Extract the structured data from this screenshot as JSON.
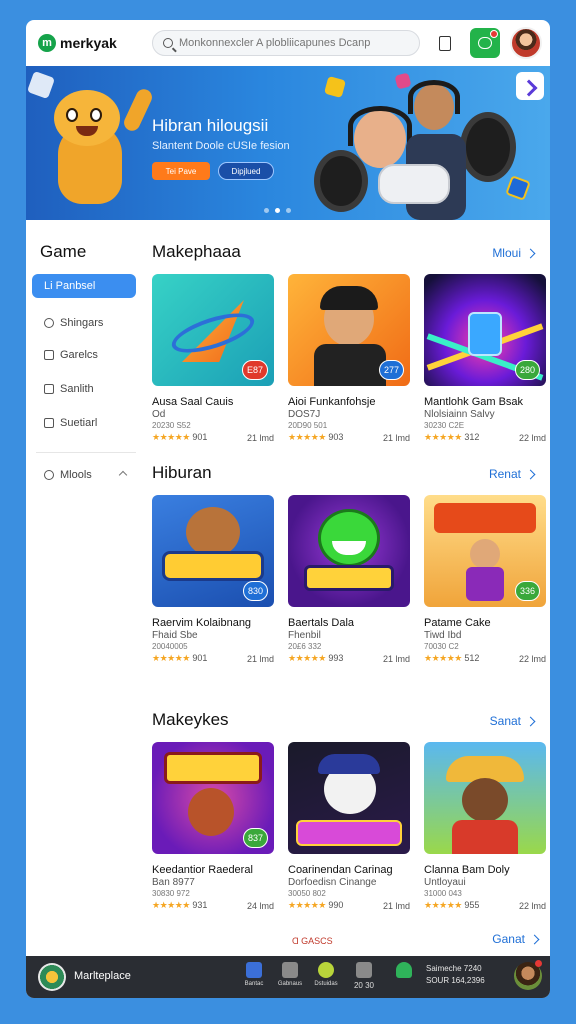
{
  "header": {
    "logo_mark": "m",
    "logo_text": "merkyak",
    "search_placeholder": "Monkonnexcler A plobliicapunes Dcanp"
  },
  "banner": {
    "title": "Hibran hilougsii",
    "subtitle": "Slantent Doole cUSIe fesion",
    "primary_button": "Tei Pave",
    "secondary_button": "Dipjlued",
    "dots": 3,
    "active_dot": 1
  },
  "sidebar": {
    "title": "Game",
    "items": [
      {
        "label": "Li Panbsel",
        "icon": "list-icon"
      },
      {
        "label": "Shingars",
        "icon": "person-icon"
      },
      {
        "label": "Garelcs",
        "icon": "square-icon"
      },
      {
        "label": "Sanlith",
        "icon": "home-icon"
      },
      {
        "label": "Suetiarl",
        "icon": "tag-icon"
      },
      {
        "label": "Mlools",
        "icon": "search-icon"
      }
    ]
  },
  "sections": [
    {
      "title": "Makephaaa",
      "more": "Mloui",
      "cards": [
        {
          "name": "Ausa Saal Cauis",
          "sub": "Od",
          "meta": "20230 S52",
          "stars": "★★★★★",
          "rating": "901",
          "size": "21 lmd",
          "badge": "E87",
          "badge_color": "#e0392b"
        },
        {
          "name": "Aioi Funkanfohsje",
          "sub": "DOS7J",
          "meta": "20D90 501",
          "stars": "★★★★★",
          "rating": "903",
          "size": "21 lmd",
          "badge": "277",
          "badge_color": "#1f6fd6"
        },
        {
          "name": "Mantlohk Gam Bsak",
          "sub": "Nlolsiainn Salvy",
          "meta": "30230 C2E",
          "stars": "★★★★★",
          "rating": "312",
          "size": "22 lmd",
          "badge": "280",
          "badge_color": "#3aa83a"
        }
      ]
    },
    {
      "title": "Hiburan",
      "more": "Renat",
      "cards": [
        {
          "name": "Raervim Kolaibnang",
          "sub": "Fhaid Sbe",
          "meta": "20040005",
          "stars": "★★★★★",
          "rating": "901",
          "size": "21 lmd",
          "badge": "830",
          "badge_color": "#1f6fd6"
        },
        {
          "name": "Baertals Dala",
          "sub": "Fhenbil",
          "meta": "20£6 332",
          "stars": "★★★★★",
          "rating": "993",
          "size": "21 lmd",
          "badge": "",
          "badge_color": ""
        },
        {
          "name": "Patame Cake",
          "sub": "Tiwd Ibd",
          "meta": "70030 C2",
          "stars": "★★★★★",
          "rating": "512",
          "size": "22 lmd",
          "badge": "336",
          "badge_color": "#3aa83a"
        }
      ]
    },
    {
      "title": "Makeykes",
      "more": "Sanat",
      "cards": [
        {
          "name": "Keedantior Raederal",
          "sub": "Ban 8977",
          "meta": "30830 972",
          "stars": "★★★★★",
          "rating": "931",
          "size": "24 lmd",
          "badge": "837",
          "badge_color": "#3aa83a"
        },
        {
          "name": "Coarinendan Carinag",
          "sub": "Dorfoedisn Cinange",
          "meta": "30050 802",
          "stars": "★★★★★",
          "rating": "990",
          "size": "21 lmd",
          "badge": "",
          "badge_color": ""
        },
        {
          "name": "Clanna Bam Doly",
          "sub": "Untloyaui",
          "meta": "31000 043",
          "stars": "★★★★★",
          "rating": "955",
          "size": "22 lmd",
          "badge": "",
          "badge_color": ""
        }
      ]
    }
  ],
  "footer_section": {
    "label": "Ɑ GASCS",
    "more": "Ganat"
  },
  "bottombar": {
    "app_name": "Marlteplace",
    "items": [
      {
        "label": "Bantac",
        "color": "#3b6fd8"
      },
      {
        "label": "Gabnaus",
        "color": "#8a8a8a"
      },
      {
        "label": "Dstuidas",
        "color": "#b8d43a"
      },
      {
        "label": "20 30",
        "color": "#8a8a8a"
      },
      {
        "label": "",
        "color": "#2fb35a"
      }
    ],
    "stat_line_1": "Saimeche 7240",
    "stat_line_2": "SOUR 164,2396"
  }
}
